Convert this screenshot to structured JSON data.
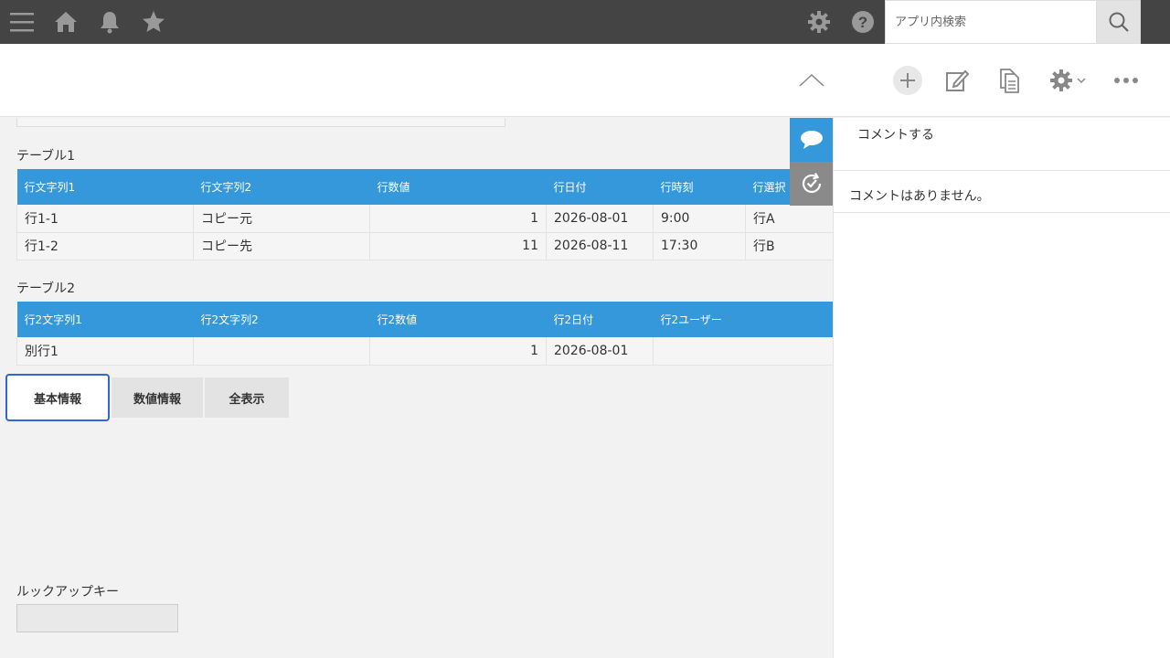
{
  "header": {
    "search_placeholder": "アプリ内検索"
  },
  "table1": {
    "label": "テーブル1",
    "columns": [
      "行文字列1",
      "行文字列2",
      "行数値",
      "行日付",
      "行時刻",
      "行選択"
    ],
    "rows": [
      [
        "行1-1",
        "コピー元",
        "1",
        "2026-08-01",
        "9:00",
        "行A"
      ],
      [
        "行1-2",
        "コピー先",
        "11",
        "2026-08-11",
        "17:30",
        "行B"
      ]
    ]
  },
  "table2": {
    "label": "テーブル2",
    "columns": [
      "行2文字列1",
      "行2文字列2",
      "行2数値",
      "行2日付",
      "行2ユーザー"
    ],
    "rows": [
      [
        "別行1",
        "",
        "1",
        "2026-08-01",
        ""
      ]
    ]
  },
  "tabs": [
    {
      "label": "基本情報",
      "active": true
    },
    {
      "label": "数値情報",
      "active": false
    },
    {
      "label": "全表示",
      "active": false
    }
  ],
  "lookup": {
    "label": "ルックアップキー",
    "value": ""
  },
  "comments": {
    "input_placeholder": "コメントする",
    "empty_message": "コメントはありません。"
  },
  "colors": {
    "topbar": "#444444",
    "table_header": "#3498db",
    "active_tab_border": "#3264dc",
    "icon_gray": "#888888"
  }
}
